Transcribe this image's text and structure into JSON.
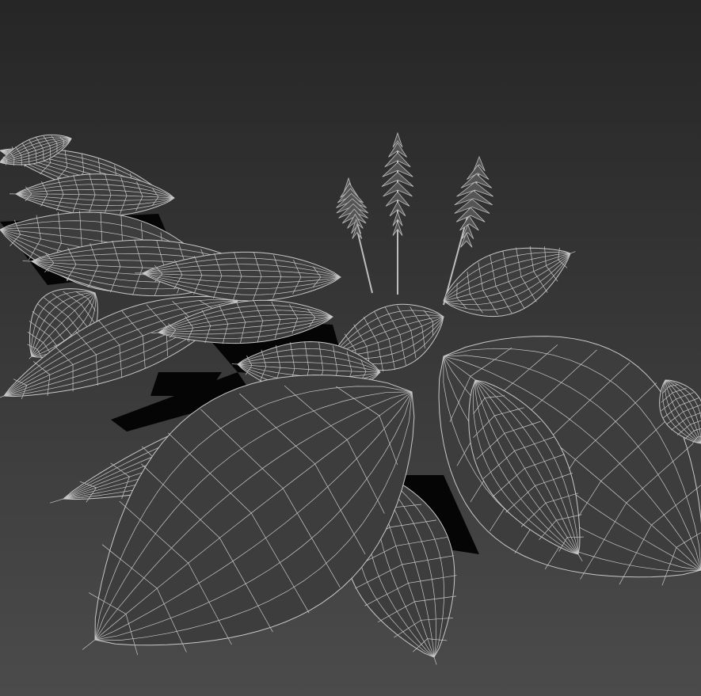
{
  "viewport": {
    "background_top": "#262626",
    "background_bottom": "#4b4b4b",
    "leaf_fill": "#3d3d3d",
    "wire_color": "#c8c8c8",
    "shadow_color": "#050505",
    "tree_color": "#bdbdbd"
  }
}
